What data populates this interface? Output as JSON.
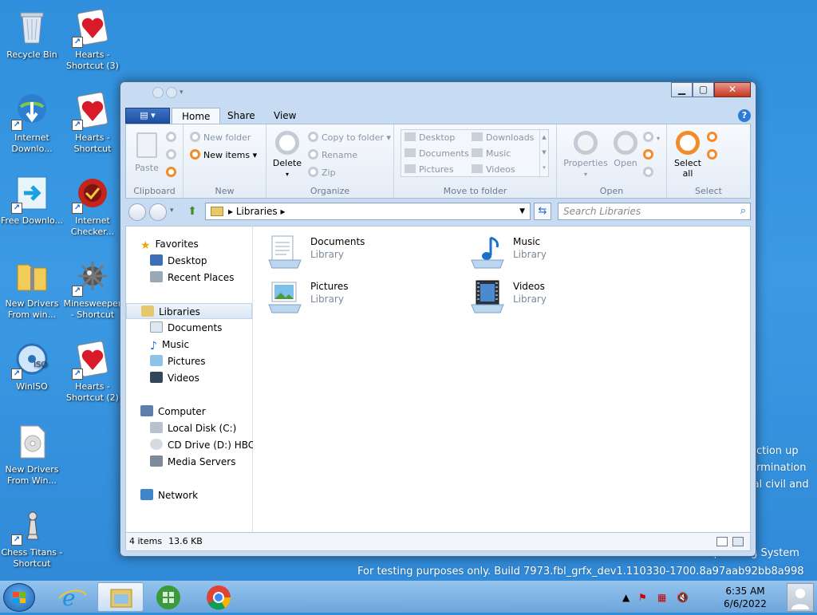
{
  "desktop": {
    "icons": [
      {
        "label": "Recycle Bin",
        "name": "recycle-bin-icon"
      },
      {
        "label": "Hearts - Shortcut (3)",
        "name": "hearts-icon"
      },
      {
        "label": "Internet Downlo...",
        "name": "internet-download-icon"
      },
      {
        "label": "Hearts - Shortcut",
        "name": "hearts-icon"
      },
      {
        "label": "Free Downlo...",
        "name": "free-download-icon"
      },
      {
        "label": "Internet Checker...",
        "name": "internet-checker-icon"
      },
      {
        "label": "New Drivers From win...",
        "name": "zip-folder-icon"
      },
      {
        "label": "Minesweeper - Shortcut",
        "name": "minesweeper-icon"
      },
      {
        "label": "WinISO",
        "name": "winiso-icon"
      },
      {
        "label": "Hearts - Shortcut (2)",
        "name": "hearts-icon"
      },
      {
        "label": "New Drivers From Win...",
        "name": "disc-file-icon"
      },
      {
        "label": "Chess Titans - Shortcut",
        "name": "chess-icon"
      }
    ],
    "watermark": {
      "line1": "action up",
      "line2": "ermination",
      "line3": "ial civil and",
      "line4": "Microsoft Pre-release Windows Operating System",
      "line5": "For testing purposes only. Build 7973.fbl_grfx_dev1.110330-1700.8a97aab92bb8a998"
    },
    "colors": {
      "background": "#3c9ae4",
      "accent": "#f28c28"
    }
  },
  "window": {
    "tabs": {
      "file": "▾",
      "home": "Home",
      "share": "Share",
      "view": "View"
    },
    "help": "?",
    "ribbon": {
      "clipboard": {
        "paste": "Paste",
        "label": "Clipboard"
      },
      "new": {
        "new_folder": "New folder",
        "new_items": "New items ▾",
        "label": "New"
      },
      "organize": {
        "delete": "Delete",
        "copy_to_folder": "Copy to folder ▾",
        "rename": "Rename",
        "zip": "Zip",
        "label": "Organize"
      },
      "move_to": {
        "desktop": "Desktop",
        "documents": "Documents",
        "pictures": "Pictures",
        "downloads": "Downloads",
        "music": "Music",
        "videos": "Videos",
        "label": "Move to folder"
      },
      "open": {
        "properties": "Properties",
        "open": "Open",
        "label": "Open"
      },
      "select": {
        "select_all": "Select all",
        "label": "Select"
      }
    },
    "address": {
      "path": "Libraries",
      "search_placeholder": "Search Libraries"
    },
    "nav": {
      "favorites": "Favorites",
      "desktop": "Desktop",
      "recent_places": "Recent Places",
      "libraries": "Libraries",
      "documents": "Documents",
      "music": "Music",
      "pictures": "Pictures",
      "videos": "Videos",
      "computer": "Computer",
      "local_disk": "Local Disk (C:)",
      "cd_drive": "CD Drive (D:) HBCD_",
      "media_servers": "Media Servers",
      "network": "Network"
    },
    "libraries": [
      {
        "name": "Documents",
        "type": "Library"
      },
      {
        "name": "Music",
        "type": "Library"
      },
      {
        "name": "Pictures",
        "type": "Library"
      },
      {
        "name": "Videos",
        "type": "Library"
      }
    ],
    "status": {
      "items": "4 items",
      "size": "13.6 KB"
    }
  },
  "taskbar": {
    "time": "6:35 AM",
    "date": "6/6/2022"
  }
}
